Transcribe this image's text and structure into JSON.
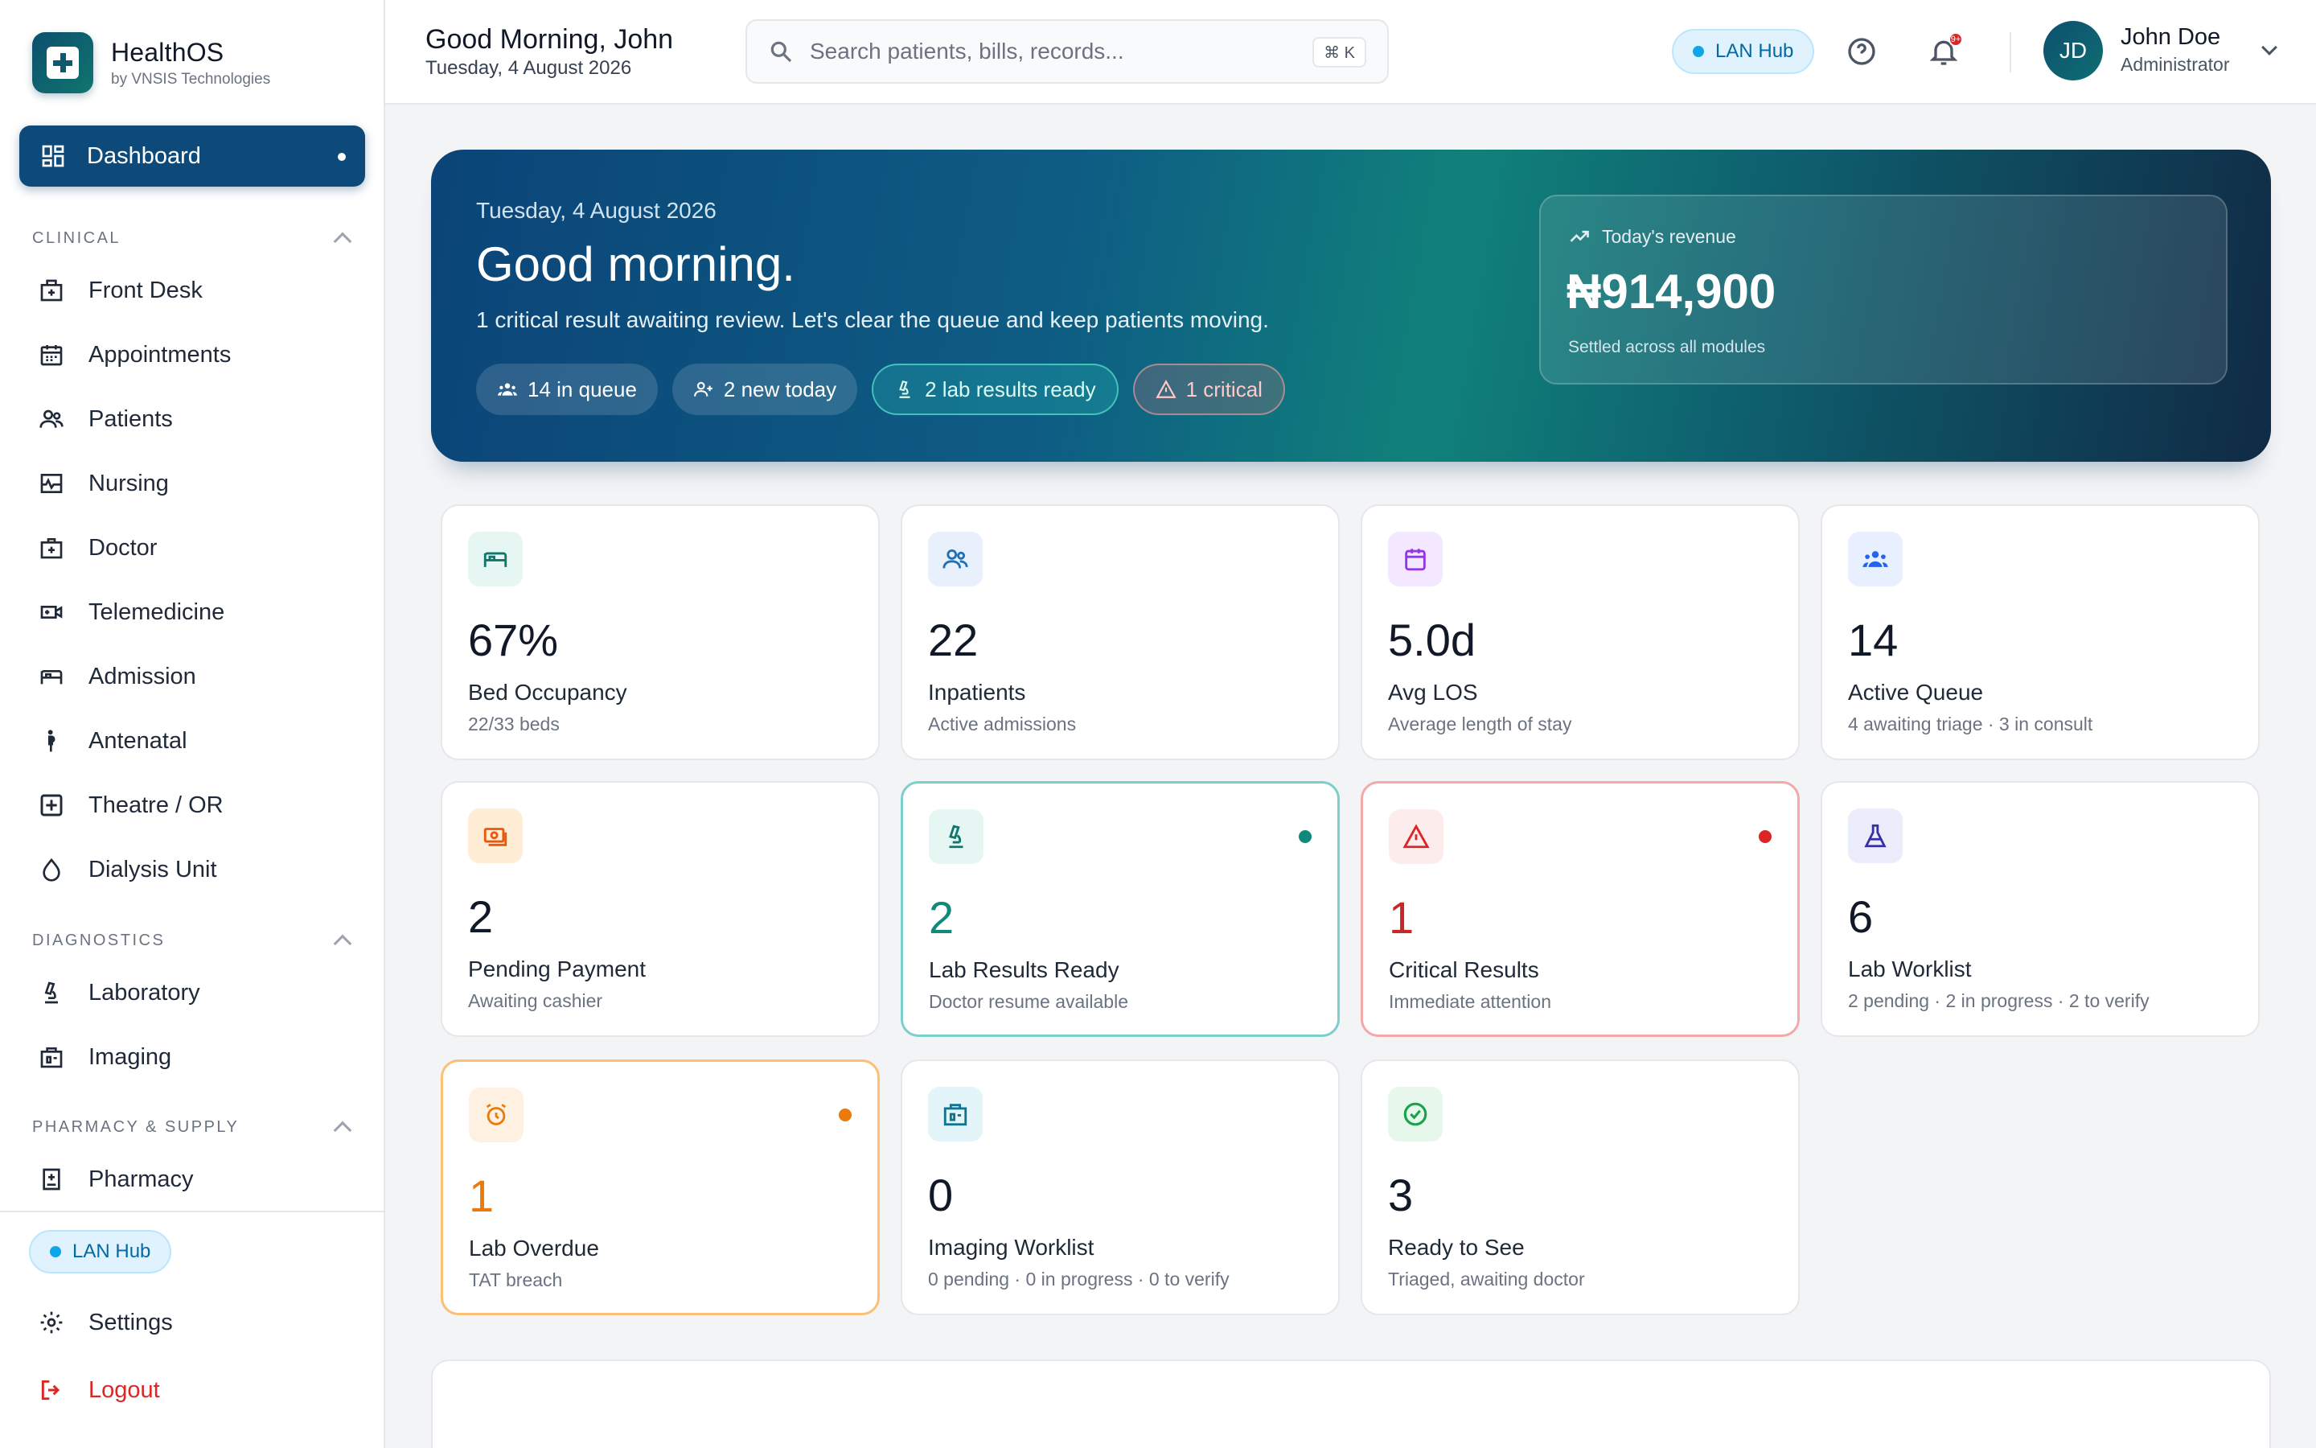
{
  "brand": {
    "name": "HealthOS",
    "sub": "by VNSIS Technologies"
  },
  "nav": {
    "active": "Dashboard",
    "sections": [
      {
        "title": "CLINICAL",
        "items": [
          "Front Desk",
          "Appointments",
          "Patients",
          "Nursing",
          "Doctor",
          "Telemedicine",
          "Admission",
          "Antenatal",
          "Theatre / OR",
          "Dialysis Unit"
        ]
      },
      {
        "title": "DIAGNOSTICS",
        "items": [
          "Laboratory",
          "Imaging"
        ]
      },
      {
        "title": "PHARMACY & SUPPLY",
        "items": [
          "Pharmacy"
        ]
      }
    ],
    "lan_hub": "LAN Hub",
    "settings": "Settings",
    "logout": "Logout"
  },
  "header": {
    "greeting": "Good Morning, John",
    "date": "Tuesday, 4 August 2026",
    "search_placeholder": "Search patients, bills, records...",
    "shortcut": "⌘ K",
    "lan_hub": "LAN Hub",
    "notification_count": "9+",
    "user": {
      "initials": "JD",
      "name": "John Doe",
      "role": "Administrator"
    }
  },
  "hero": {
    "date": "Tuesday, 4 August 2026",
    "title": "Good morning.",
    "message": "1 critical result awaiting review. Let's clear the queue and keep patients moving.",
    "chips": [
      "14 in queue",
      "2 new today",
      "2 lab results ready",
      "1 critical"
    ],
    "revenue": {
      "label": "Today's revenue",
      "value": "₦914,900",
      "sub": "Settled across all modules"
    }
  },
  "stats": [
    {
      "value": "67%",
      "label": "Bed Occupancy",
      "sub": "22/33 beds",
      "icon": "bed-icon",
      "color": "#0f766e",
      "bg": "#e6f6f3"
    },
    {
      "value": "22",
      "label": "Inpatients",
      "sub": "Active admissions",
      "icon": "users-icon",
      "color": "#1d6fb8",
      "bg": "#e8f1fb"
    },
    {
      "value": "5.0d",
      "label": "Avg LOS",
      "sub": "Average length of stay",
      "icon": "calendar-icon",
      "color": "#9333ea",
      "bg": "#f3e8ff"
    },
    {
      "value": "14",
      "label": "Active Queue",
      "sub": "4 awaiting triage · 3 in consult",
      "icon": "group-icon",
      "color": "#2563eb",
      "bg": "#e8efff"
    },
    {
      "value": "2",
      "label": "Pending Payment",
      "sub": "Awaiting cashier",
      "icon": "cash-icon",
      "color": "#ea580c",
      "bg": "#ffedd5"
    },
    {
      "value": "2",
      "label": "Lab Results Ready",
      "sub": "Doctor resume available",
      "icon": "microscope-icon",
      "color": "#0f766e",
      "bg": "#e6f6f3",
      "accent": "#0f8a7a"
    },
    {
      "value": "1",
      "label": "Critical Results",
      "sub": "Immediate attention",
      "icon": "warning-icon",
      "color": "#dc2626",
      "bg": "#fdecec",
      "accent": "#dc2626"
    },
    {
      "value": "6",
      "label": "Lab Worklist",
      "sub": "2 pending · 2 in progress · 2 to verify",
      "icon": "flask-icon",
      "color": "#3730a3",
      "bg": "#ecedfb"
    },
    {
      "value": "1",
      "label": "Lab Overdue",
      "sub": "TAT breach",
      "icon": "alarm-icon",
      "color": "#ea7a0c",
      "bg": "#fff1e2",
      "accent": "#ea7a0c"
    },
    {
      "value": "0",
      "label": "Imaging Worklist",
      "sub": "0 pending · 0 in progress · 0 to verify",
      "icon": "scan-icon",
      "color": "#0e7490",
      "bg": "#e3f5f8"
    },
    {
      "value": "3",
      "label": "Ready to See",
      "sub": "Triaged, awaiting doctor",
      "icon": "check-circle-icon",
      "color": "#16a34a",
      "bg": "#e8f7ec"
    }
  ]
}
